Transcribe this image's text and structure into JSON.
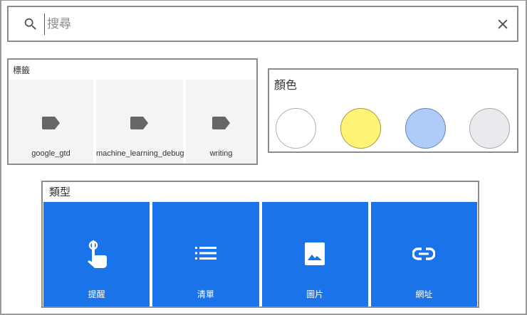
{
  "search": {
    "placeholder": "搜尋",
    "value": ""
  },
  "labels": {
    "title": "標籤",
    "items": [
      {
        "label": "google_gtd"
      },
      {
        "label": "machine_learning_debug"
      },
      {
        "label": "writing"
      }
    ]
  },
  "colors": {
    "title": "顏色",
    "swatches": [
      {
        "name": "white",
        "fill": "#ffffff",
        "stroke": "#b0b0b0"
      },
      {
        "name": "yellow",
        "fill": "#fff475",
        "stroke": "#a89a40"
      },
      {
        "name": "blue",
        "fill": "#aecbfa",
        "stroke": "#6a85b0"
      },
      {
        "name": "gray",
        "fill": "#e8eaed",
        "stroke": "#a8a8a8"
      }
    ]
  },
  "types": {
    "title": "類型",
    "items": [
      {
        "label": "提醒",
        "icon": "touch-icon"
      },
      {
        "label": "清單",
        "icon": "list-icon"
      },
      {
        "label": "圖片",
        "icon": "image-icon"
      },
      {
        "label": "網址",
        "icon": "link-icon"
      }
    ]
  }
}
